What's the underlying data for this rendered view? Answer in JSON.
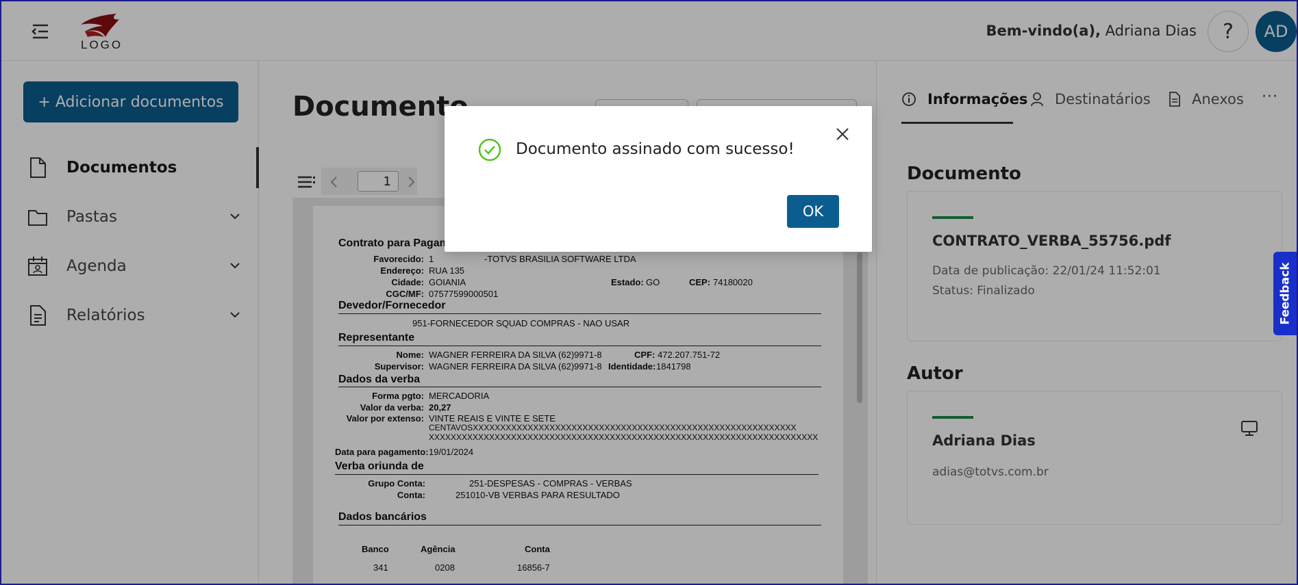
{
  "header": {
    "logo_text": "LOGO",
    "welcome_prefix": "Bem-vindo(a),",
    "welcome_name": " Adriana Dias",
    "help_label": "?",
    "avatar_initials": "AD"
  },
  "sidebar": {
    "add_button": "+ Adicionar documentos",
    "items": [
      {
        "label": "Documentos",
        "icon": "document-icon",
        "active": true
      },
      {
        "label": "Pastas",
        "icon": "folder-icon"
      },
      {
        "label": "Agenda",
        "icon": "calendar-icon"
      },
      {
        "label": "Relatórios",
        "icon": "report-icon"
      }
    ]
  },
  "main": {
    "title": "Documento",
    "viewer": {
      "page_number": "1"
    },
    "document": {
      "title": "Contrato para Pagam",
      "favorecido_label": "Favorecido:",
      "favorecido_value": "1",
      "favorecido_name": "-TOTVS BRASILIA SOFTWARE LTDA",
      "endereco_label": "Endereço:",
      "endereco_value": "RUA 135",
      "cidade_label": "Cidade:",
      "cidade_value": "GOIANIA",
      "estado_label": "Estado:",
      "estado_value": "GO",
      "cep_label": "CEP:",
      "cep_value": "74180020",
      "cgc_label": "CGC/MF:",
      "cgc_value": "07577599000501",
      "devedor_section": "Devedor/Fornecedor",
      "devedor_value": "951-FORNECEDOR SQUAD COMPRAS - NAO USAR",
      "representante_section": "Representante",
      "nome_label": "Nome:",
      "nome_value": "WAGNER FERREIRA DA SILVA (62)9971-8",
      "cpf_label": "CPF:",
      "cpf_value": "472.207.751-72",
      "supervisor_label": "Supervisor:",
      "supervisor_value": "WAGNER FERREIRA DA SILVA (62)9971-8",
      "identidade_label": "Identidade:",
      "identidade_value": "1841798",
      "verba_section": "Dados da verba",
      "forma_label": "Forma pgto:",
      "forma_value": "MERCADORIA",
      "valor_label": "Valor da verba:",
      "valor_value": "20,27",
      "extenso_label": "Valor por extenso:",
      "extenso_line1": "VINTE REAIS E VINTE E SETE",
      "extenso_line2": "CENTAVOSXXXXXXXXXXXXXXXXXXXXXXXXXXXXXXXXXXXXXXXXXXXXXXXXXXXXXXXXXXX",
      "extenso_line3": "XXXXXXXXXXXXXXXXXXXXXXXXXXXXXXXXXXXXXXXXXXXXXXXXXXXXXXXXXXXXXXXXXXXXXXX",
      "data_label": "Data para pagamento:",
      "data_value": "19/01/2024",
      "oriunda_section": "Verba oriunda de",
      "grupo_label": "Grupo Conta:",
      "grupo_value": "251-DESPESAS - COMPRAS - VERBAS",
      "conta_label": "Conta:",
      "conta_value": "251010-VB VERBAS PARA RESULTADO",
      "bancarios_section": "Dados bancários",
      "col_banco": "Banco",
      "col_agencia": "Agência",
      "col_conta": "Conta",
      "banco_value": "341",
      "agencia_value": "0208",
      "conta_bank_value": "16856-7"
    }
  },
  "right_panel": {
    "tabs": [
      "Informações",
      "Destinatários",
      "Anexos"
    ],
    "more_label": "···",
    "documento_section": "Documento",
    "file_name": "CONTRATO_VERBA_55756.pdf",
    "publication": "Data de publicação: 22/01/24 11:52:01",
    "status": "Status: Finalizado",
    "autor_section": "Autor",
    "author_name": "Adriana Dias",
    "author_email": "adias@totvs.com.br"
  },
  "feedback_label": "Feedback",
  "modal": {
    "message": "Documento assinado com sucesso!",
    "ok_label": "OK"
  },
  "colors": {
    "primary": "#0b5d8f",
    "success": "#52c41a",
    "accent_green": "#1d8a4b",
    "feedback": "#1a2ec9"
  }
}
